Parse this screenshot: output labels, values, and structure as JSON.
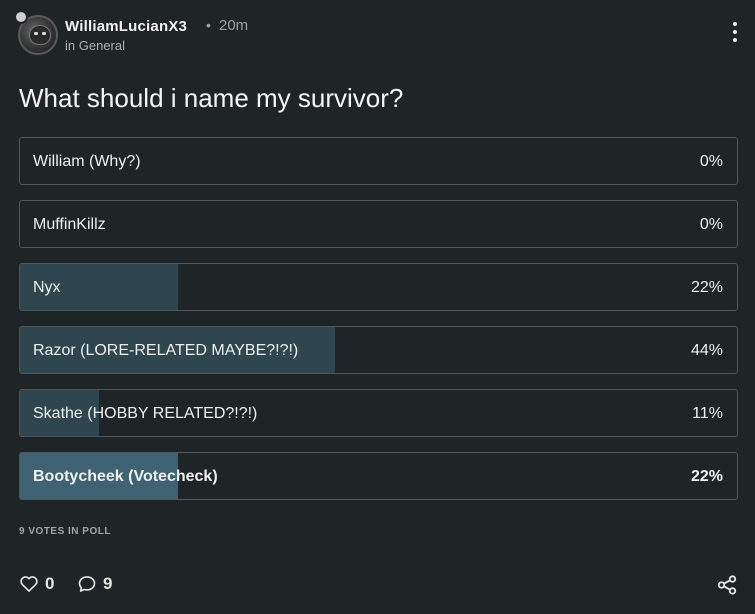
{
  "post": {
    "author": "WilliamLucianX3",
    "separator": "•",
    "time": "20m",
    "category": "in General",
    "question": "What should i name my survivor?"
  },
  "poll": {
    "options": [
      {
        "label": "William (Why?)",
        "percent_text": "0%",
        "percent": 0,
        "selected": false
      },
      {
        "label": "MuffinKillz",
        "percent_text": "0%",
        "percent": 0,
        "selected": false
      },
      {
        "label": "Nyx",
        "percent_text": "22%",
        "percent": 22,
        "selected": false
      },
      {
        "label": "Razor (LORE-RELATED MAYBE?!?!)",
        "percent_text": "44%",
        "percent": 44,
        "selected": false
      },
      {
        "label": "Skathe (HOBBY RELATED?!?!)",
        "percent_text": "11%",
        "percent": 11,
        "selected": false
      },
      {
        "label": "Bootycheek (Votecheck)",
        "percent_text": "22%",
        "percent": 22,
        "selected": true
      }
    ],
    "votes_text": "9 VOTES IN POLL"
  },
  "footer": {
    "likes": "0",
    "comments": "9",
    "like_icon": "heart-outline-icon",
    "comment_icon": "speech-bubble-icon",
    "share_icon": "share-icon"
  },
  "colors": {
    "background": "#1f2526",
    "bar_fill": "#2f4650",
    "bar_fill_selected": "#3e6272",
    "border": "#4d5658"
  }
}
